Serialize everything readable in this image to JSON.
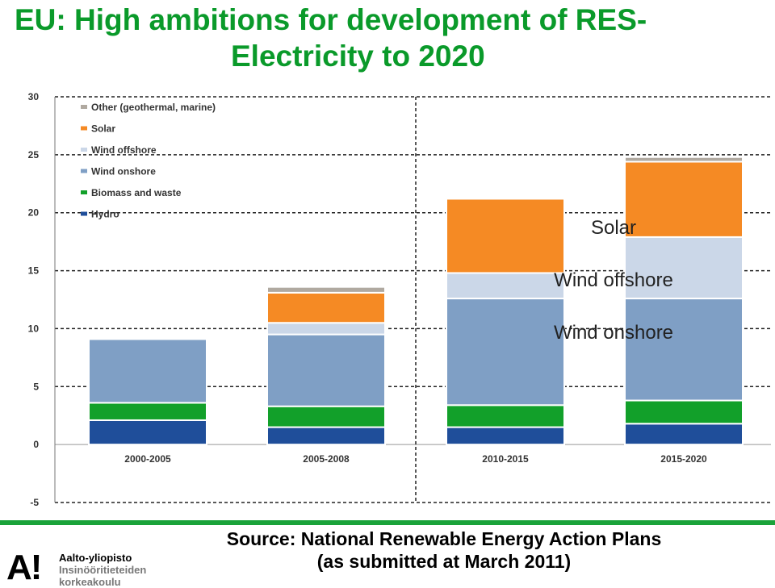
{
  "title": {
    "line1": "EU: High ambitions for development of RES-",
    "line2": "Electricity to 2020"
  },
  "source": {
    "line1": "Source: National Renewable Energy Action Plans",
    "line2": "(as submitted at March 2011)"
  },
  "logo": {
    "mark": "A!",
    "line1": "Aalto-yliopisto",
    "line2": "Insinööritieteiden",
    "line3": "korkeakoulu"
  },
  "colors": {
    "title": "#0a9a2a",
    "accent_rule": "#1aa33a"
  },
  "chart_data": {
    "type": "bar",
    "stacked": true,
    "categories": [
      "2000-2005",
      "2005-2008",
      "2010-2015",
      "2015-2020"
    ],
    "ylim": [
      -5,
      30
    ],
    "yticks": [
      -5,
      0,
      5,
      10,
      15,
      20,
      25,
      30
    ],
    "grid": true,
    "legend_position": "top-left",
    "series": [
      {
        "name": "Hydro",
        "color": "#1f4e9a",
        "values": [
          2.1,
          1.5,
          1.5,
          1.8
        ]
      },
      {
        "name": "Biomass and waste",
        "color": "#12a02a",
        "values": [
          1.5,
          1.8,
          1.9,
          2.0
        ]
      },
      {
        "name": "Wind onshore",
        "color": "#7f9fc5",
        "values": [
          5.5,
          6.2,
          9.2,
          8.8
        ]
      },
      {
        "name": "Wind offshore",
        "color": "#cbd7e8",
        "values": [
          0.1,
          1.0,
          2.2,
          5.3
        ]
      },
      {
        "name": "Solar",
        "color": "#f58a24",
        "values": [
          0.1,
          2.6,
          6.4,
          6.5
        ]
      },
      {
        "name": "Other (geothermal, marine)",
        "color": "#b0a9a0",
        "values": [
          0.0,
          0.5,
          0.0,
          0.4
        ]
      }
    ],
    "annotations": [
      "Solar",
      "Wind offshore",
      "Wind onshore"
    ]
  }
}
